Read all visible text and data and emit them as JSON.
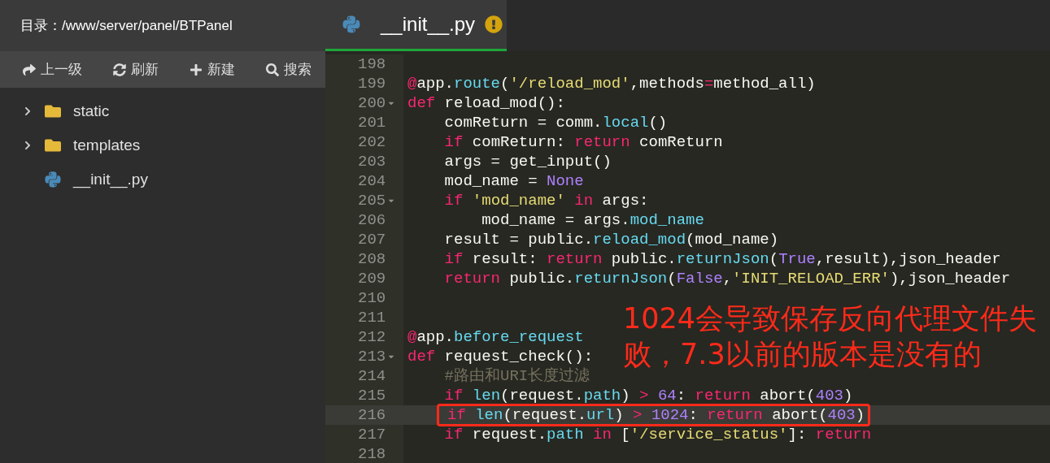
{
  "sidebar": {
    "path_label": "目录：/www/server/panel/BTPanel",
    "toolbar": [
      {
        "kind": "up",
        "label": "上一级"
      },
      {
        "kind": "refresh",
        "label": "刷新"
      },
      {
        "kind": "new",
        "label": "新建"
      },
      {
        "kind": "search",
        "label": "搜索"
      }
    ],
    "tree": [
      {
        "kind": "folder",
        "name": "static",
        "expanded": false
      },
      {
        "kind": "folder",
        "name": "templates",
        "expanded": false
      },
      {
        "kind": "python",
        "name": "__init__.py"
      }
    ]
  },
  "editor": {
    "tabs": [
      {
        "label": "__init__.py",
        "selected": true,
        "unsaved_warning": true
      }
    ],
    "lines": [
      {
        "n": "198",
        "fold": false,
        "current": false,
        "boxed": false
      },
      {
        "n": "199",
        "fold": false,
        "current": false,
        "boxed": false,
        "tokens": [
          {
            "kind": "kw",
            "t": "@"
          },
          {
            "kind": "p",
            "t": "app."
          },
          {
            "kind": "fn",
            "t": "route"
          },
          {
            "kind": "p",
            "t": "("
          },
          {
            "kind": "str",
            "t": "'/reload_mod'"
          },
          {
            "kind": "p",
            "t": ",methods"
          },
          {
            "kind": "kw",
            "t": "="
          },
          {
            "kind": "p",
            "t": "method_all)"
          }
        ]
      },
      {
        "n": "200",
        "fold": true,
        "current": false,
        "boxed": false,
        "tokens": [
          {
            "kind": "kw",
            "t": "def"
          },
          {
            "kind": "p",
            "t": " reload_mod():"
          }
        ]
      },
      {
        "n": "201",
        "fold": false,
        "current": false,
        "boxed": false,
        "tokens": [
          {
            "kind": "p",
            "t": "    comReturn = comm."
          },
          {
            "kind": "fn",
            "t": "local"
          },
          {
            "kind": "p",
            "t": "()"
          }
        ]
      },
      {
        "n": "202",
        "fold": false,
        "current": false,
        "boxed": false,
        "tokens": [
          {
            "kind": "kw",
            "t": "    if"
          },
          {
            "kind": "p",
            "t": " comReturn: "
          },
          {
            "kind": "kw",
            "t": "return"
          },
          {
            "kind": "p",
            "t": " comReturn"
          }
        ]
      },
      {
        "n": "203",
        "fold": false,
        "current": false,
        "boxed": false,
        "tokens": [
          {
            "kind": "p",
            "t": "    args = get_input()"
          }
        ]
      },
      {
        "n": "204",
        "fold": false,
        "current": false,
        "boxed": false,
        "tokens": [
          {
            "kind": "p",
            "t": "    mod_name = "
          },
          {
            "kind": "num",
            "t": "None"
          }
        ]
      },
      {
        "n": "205",
        "fold": true,
        "current": false,
        "boxed": false,
        "tokens": [
          {
            "kind": "kw",
            "t": "    if"
          },
          {
            "kind": "str",
            "t": " 'mod_name'"
          },
          {
            "kind": "kw",
            "t": " in"
          },
          {
            "kind": "p",
            "t": " args:"
          }
        ]
      },
      {
        "n": "206",
        "fold": false,
        "current": false,
        "boxed": false,
        "tokens": [
          {
            "kind": "p",
            "t": "        mod_name = args."
          },
          {
            "kind": "fn",
            "t": "mod_name"
          }
        ]
      },
      {
        "n": "207",
        "fold": false,
        "current": false,
        "boxed": false,
        "tokens": [
          {
            "kind": "p",
            "t": "    result = public."
          },
          {
            "kind": "fn",
            "t": "reload_mod"
          },
          {
            "kind": "p",
            "t": "(mod_name)"
          }
        ]
      },
      {
        "n": "208",
        "fold": false,
        "current": false,
        "boxed": false,
        "tokens": [
          {
            "kind": "kw",
            "t": "    if"
          },
          {
            "kind": "p",
            "t": " result: "
          },
          {
            "kind": "kw",
            "t": "return"
          },
          {
            "kind": "p",
            "t": " public."
          },
          {
            "kind": "fn",
            "t": "returnJson"
          },
          {
            "kind": "p",
            "t": "("
          },
          {
            "kind": "num",
            "t": "True"
          },
          {
            "kind": "p",
            "t": ",result),json_header"
          }
        ]
      },
      {
        "n": "209",
        "fold": false,
        "current": false,
        "boxed": false,
        "tokens": [
          {
            "kind": "kw",
            "t": "    return"
          },
          {
            "kind": "p",
            "t": " public."
          },
          {
            "kind": "fn",
            "t": "returnJson"
          },
          {
            "kind": "p",
            "t": "("
          },
          {
            "kind": "num",
            "t": "False"
          },
          {
            "kind": "p",
            "t": ","
          },
          {
            "kind": "str",
            "t": "'INIT_RELOAD_ERR'"
          },
          {
            "kind": "p",
            "t": "),json_header"
          }
        ]
      },
      {
        "n": "210",
        "fold": false,
        "current": false,
        "boxed": false
      },
      {
        "n": "211",
        "fold": false,
        "current": false,
        "boxed": false
      },
      {
        "n": "212",
        "fold": false,
        "current": false,
        "boxed": false,
        "tokens": [
          {
            "kind": "kw",
            "t": "@"
          },
          {
            "kind": "p",
            "t": "app."
          },
          {
            "kind": "fn",
            "t": "before_request"
          }
        ]
      },
      {
        "n": "213",
        "fold": true,
        "current": false,
        "boxed": false,
        "tokens": [
          {
            "kind": "kw",
            "t": "def"
          },
          {
            "kind": "p",
            "t": " request_check():"
          }
        ]
      },
      {
        "n": "214",
        "fold": false,
        "current": false,
        "boxed": false,
        "tokens": [
          {
            "kind": "cmt",
            "t": "    #路由和URI长度过滤"
          }
        ]
      },
      {
        "n": "215",
        "fold": false,
        "current": false,
        "boxed": false,
        "tokens": [
          {
            "kind": "kw",
            "t": "    if"
          },
          {
            "kind": "fn",
            "t": " len"
          },
          {
            "kind": "p",
            "t": "(request."
          },
          {
            "kind": "fn",
            "t": "path"
          },
          {
            "kind": "p",
            "t": ") "
          },
          {
            "kind": "kw",
            "t": ">"
          },
          {
            "kind": "num",
            "t": " 64"
          },
          {
            "kind": "p",
            "t": ": "
          },
          {
            "kind": "kw",
            "t": "return"
          },
          {
            "kind": "p",
            "t": " abort("
          },
          {
            "kind": "num",
            "t": "403"
          },
          {
            "kind": "p",
            "t": ")"
          }
        ]
      },
      {
        "n": "216",
        "fold": false,
        "current": true,
        "boxed": true,
        "tokens": [
          {
            "kind": "kw",
            "t": "if"
          },
          {
            "kind": "fn",
            "t": " len"
          },
          {
            "kind": "p",
            "t": "(request."
          },
          {
            "kind": "fn",
            "t": "url"
          },
          {
            "kind": "p",
            "t": ") "
          },
          {
            "kind": "kw",
            "t": ">"
          },
          {
            "kind": "num",
            "t": " 1024"
          },
          {
            "kind": "p",
            "t": ": "
          },
          {
            "kind": "kw",
            "t": "return"
          },
          {
            "kind": "p",
            "t": " abort("
          },
          {
            "kind": "num",
            "t": "403"
          },
          {
            "kind": "p",
            "t": ")"
          }
        ]
      },
      {
        "n": "217",
        "fold": false,
        "current": false,
        "boxed": false,
        "tokens": [
          {
            "kind": "kw",
            "t": "    if"
          },
          {
            "kind": "p",
            "t": " request."
          },
          {
            "kind": "fn",
            "t": "path"
          },
          {
            "kind": "kw",
            "t": " in"
          },
          {
            "kind": "p",
            "t": " ["
          },
          {
            "kind": "str",
            "t": "'/service_status'"
          },
          {
            "kind": "p",
            "t": "]: "
          },
          {
            "kind": "kw",
            "t": "return"
          }
        ]
      },
      {
        "n": "218",
        "fold": false,
        "current": false,
        "boxed": false
      }
    ],
    "annotation": "1024会导致保存反向代理文件失败，7.3以前的版本是没有的"
  }
}
